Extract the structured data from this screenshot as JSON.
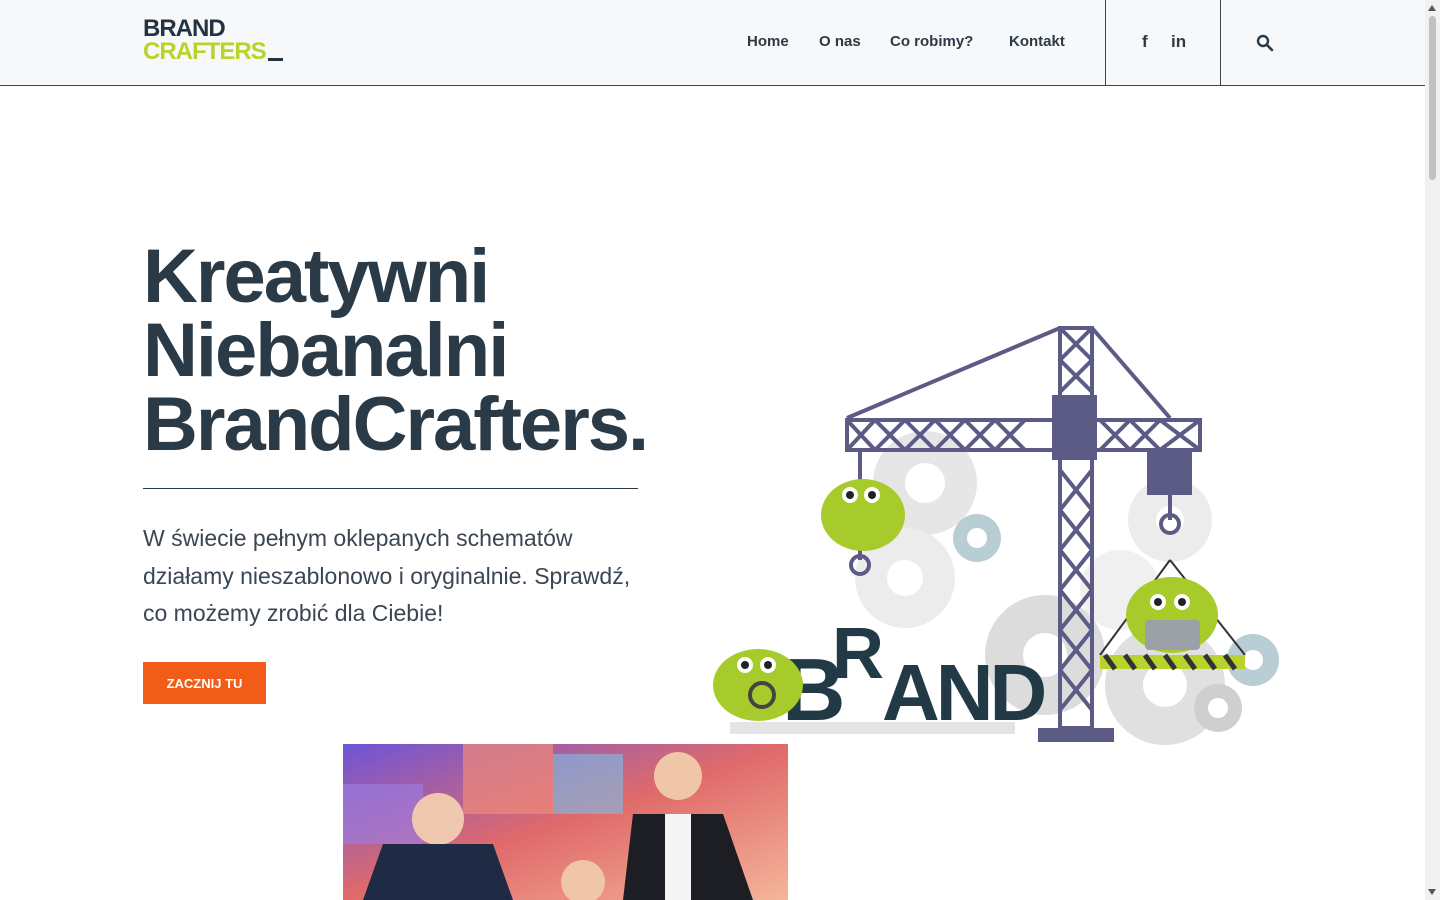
{
  "header": {
    "logo": {
      "line1": "BRAND",
      "line2": "CRAFTERS"
    },
    "nav": [
      {
        "label": "Home"
      },
      {
        "label": "O nas"
      },
      {
        "label": "Co robimy?"
      },
      {
        "label": "Kontakt"
      }
    ],
    "social": {
      "facebook": "f",
      "linkedin": "in"
    },
    "search_icon": "search-icon"
  },
  "hero": {
    "headline": [
      "Kreatywni",
      "Niebanalni",
      "BrandCrafters."
    ],
    "text": "W świecie pełnym oklepanych schematów działamy nieszablonowo i oryginalnie. Sprawdź, co możemy zrobić dla Ciebie!",
    "cta_label": "ZACZNIJ TU",
    "illustration_text": {
      "letter_b": "B",
      "letter_r": "R",
      "letters_and": "AND"
    }
  },
  "colors": {
    "brand_dark": "#2b3a47",
    "brand_lime": "#b9d32c",
    "cta_orange": "#f25c19",
    "crane_purple": "#5b5b86"
  }
}
